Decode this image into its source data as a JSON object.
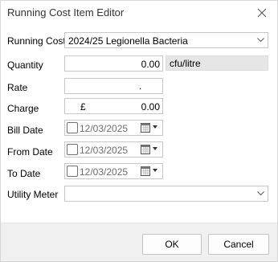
{
  "window": {
    "title": "Running Cost Item Editor",
    "close_icon": "close-icon"
  },
  "fields": {
    "running_cost": {
      "label": "Running Cost",
      "value": "2024/25 Legionella Bacteria"
    },
    "quantity": {
      "label": "Quantity",
      "value": "0.00",
      "unit": "cfu/litre"
    },
    "rate": {
      "label": "Rate",
      "value": "."
    },
    "charge": {
      "label": "Charge",
      "currency": "£",
      "value": "0.00"
    },
    "bill_date": {
      "label": "Bill Date",
      "value": "12/03/2025"
    },
    "from_date": {
      "label": "From Date",
      "value": "12/03/2025"
    },
    "to_date": {
      "label": "To Date",
      "value": "12/03/2025"
    },
    "utility_meter": {
      "label": "Utility Meter",
      "value": ""
    }
  },
  "buttons": {
    "ok": "OK",
    "cancel": "Cancel"
  }
}
